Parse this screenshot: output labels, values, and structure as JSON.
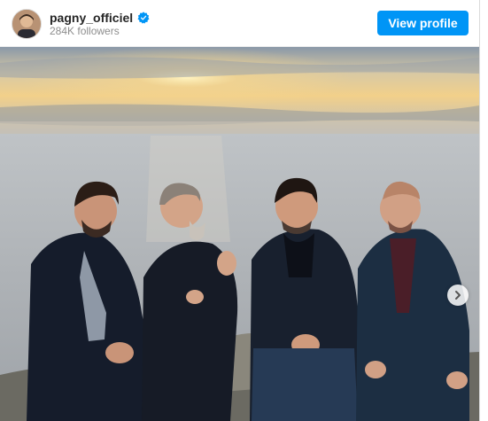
{
  "post": {
    "username": "pagny_officiel",
    "followers": "284K followers",
    "view_profile_label": "View profile",
    "verified": true
  },
  "icons": {
    "verified": "verified-badge-icon",
    "next": "chevron-right-icon"
  },
  "colors": {
    "button": "#0095f6",
    "verified": "#0095f6"
  }
}
